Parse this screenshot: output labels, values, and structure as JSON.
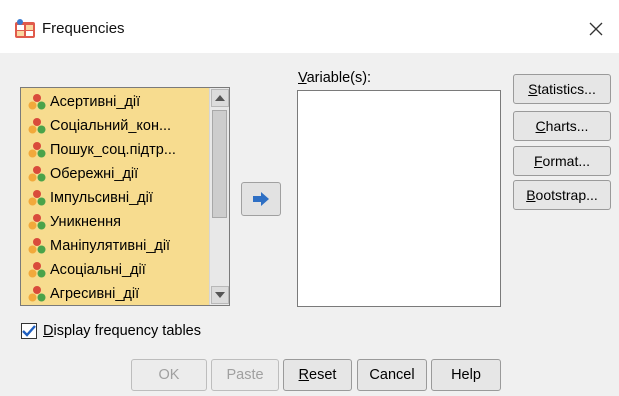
{
  "window": {
    "title": "Frequencies"
  },
  "source_variables": [
    {
      "label": "Асертивні_дії"
    },
    {
      "label": "Соціальний_кон..."
    },
    {
      "label": "Пошук_соц.підтр..."
    },
    {
      "label": "Обережні_дії"
    },
    {
      "label": "Імпульсивні_дії"
    },
    {
      "label": "Уникнення"
    },
    {
      "label": "Маніпулятивні_дії"
    },
    {
      "label": "Асоціальні_дії"
    },
    {
      "label": "Агресивні_дії"
    }
  ],
  "target": {
    "label_mnemonic": "V",
    "label_rest": "ariable(s):"
  },
  "side_buttons": [
    {
      "mnemonic": "S",
      "rest": "tatistics..."
    },
    {
      "mnemonic": "C",
      "rest": "harts..."
    },
    {
      "mnemonic": "F",
      "rest": "ormat..."
    },
    {
      "mnemonic": "B",
      "rest": "ootstrap..."
    }
  ],
  "options": {
    "display_tables_mnemonic": "D",
    "display_tables_rest": "isplay frequency tables",
    "display_tables_checked": true
  },
  "bottom_buttons": {
    "ok": "OK",
    "paste": "Paste",
    "reset_mnemonic": "R",
    "reset_rest": "eset",
    "cancel": "Cancel",
    "help": "Help"
  },
  "colors": {
    "source_bg": "#f7dc8f",
    "arrow": "#2e6fc4",
    "check": "#1f5fbf"
  },
  "icons": {
    "app": "table-app-icon",
    "variable": "nominal-variable-icon",
    "move": "arrow-right-icon",
    "close": "close-icon"
  }
}
